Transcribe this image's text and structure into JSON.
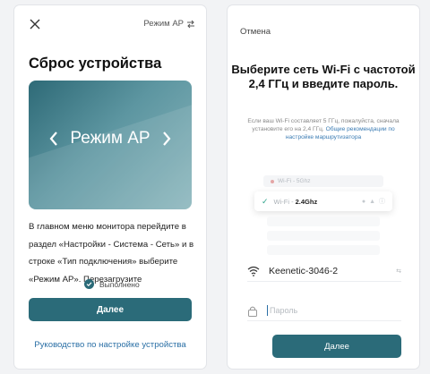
{
  "left": {
    "close_icon": "close-icon",
    "ap_mode_label": "Режим AP",
    "title": "Сброс устройства",
    "card_text": "Режим AP",
    "instruction": "В главном меню монитора перейдите в раздел «Настройки - Система - Сеть» и в строке «Тип подключения» выберите «Режим AP». Перезагрузите",
    "done_label": "Выполнено",
    "next_button": "Далее",
    "guide_link": "Руководство по настройке устройства"
  },
  "right": {
    "cancel_label": "Отмена",
    "title": "Выберите сеть Wi-Fi с частотой 2,4 ГГц и введите пароль.",
    "hint_text": "Если ваш Wi-Fi составляет 5 ГГц, пожалуйста, сначала установите его на 2,4 ГГц.",
    "hint_link": "Общие рекомендации по настройке маршрутизатора",
    "network_5g": "Wi-Fi - 5Ghz",
    "network_24_prefix": "Wi-Fi - ",
    "network_24_bold": "2.4Ghz",
    "ssid_value": "Keenetic-3046-2",
    "ssid_swap": "⇆",
    "password_placeholder": "Пароль",
    "next_button": "Далее"
  },
  "colors": {
    "accent": "#2b6b79",
    "link": "#2a6fa5",
    "background": "#f2f3f5"
  }
}
